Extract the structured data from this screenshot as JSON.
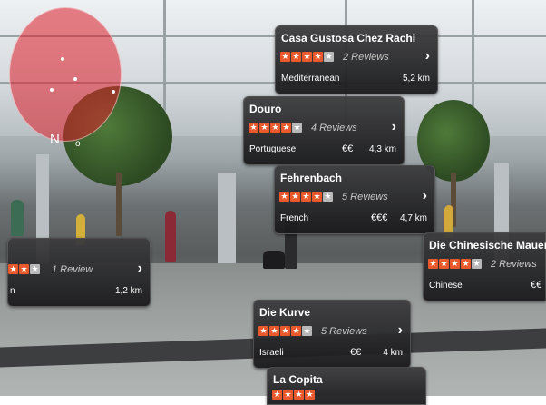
{
  "radar": {
    "north_label": "N",
    "secondary_label": "o"
  },
  "restaurants": [
    {
      "name": "Casa Gustosa Chez Rachi",
      "stars_on": 4,
      "reviews": "2 Reviews",
      "cuisine": "Mediterranean",
      "price": "",
      "distance": "5,2 km"
    },
    {
      "name": "Douro",
      "stars_on": 4,
      "reviews": "4 Reviews",
      "cuisine": "Portuguese",
      "price": "€€",
      "distance": "4,3 km"
    },
    {
      "name": "Fehrenbach",
      "stars_on": 4,
      "reviews": "5 Reviews",
      "cuisine": "French",
      "price": "€€€",
      "distance": "4,7 km"
    },
    {
      "name": "",
      "stars_on": 2,
      "reviews": "1 Review",
      "cuisine": "n",
      "price": "",
      "distance": "1,2 km"
    },
    {
      "name": "Die Chinesische Mauer",
      "stars_on": 4,
      "reviews": "2 Reviews",
      "cuisine": "Chinese",
      "price": "€€",
      "distance": ""
    },
    {
      "name": "Die Kurve",
      "stars_on": 4,
      "reviews": "5 Reviews",
      "cuisine": "Israeli",
      "price": "€€",
      "distance": "4 km"
    },
    {
      "name": "La Copita",
      "stars_on": 2,
      "reviews": "",
      "cuisine": "",
      "price": "",
      "distance": ""
    }
  ],
  "colors": {
    "star_on": "#e9592b",
    "star_off": "#b8b8b8",
    "radar": "#dc1e28"
  },
  "icons": {
    "chevron": "chevron-right-icon",
    "star": "star-icon"
  }
}
